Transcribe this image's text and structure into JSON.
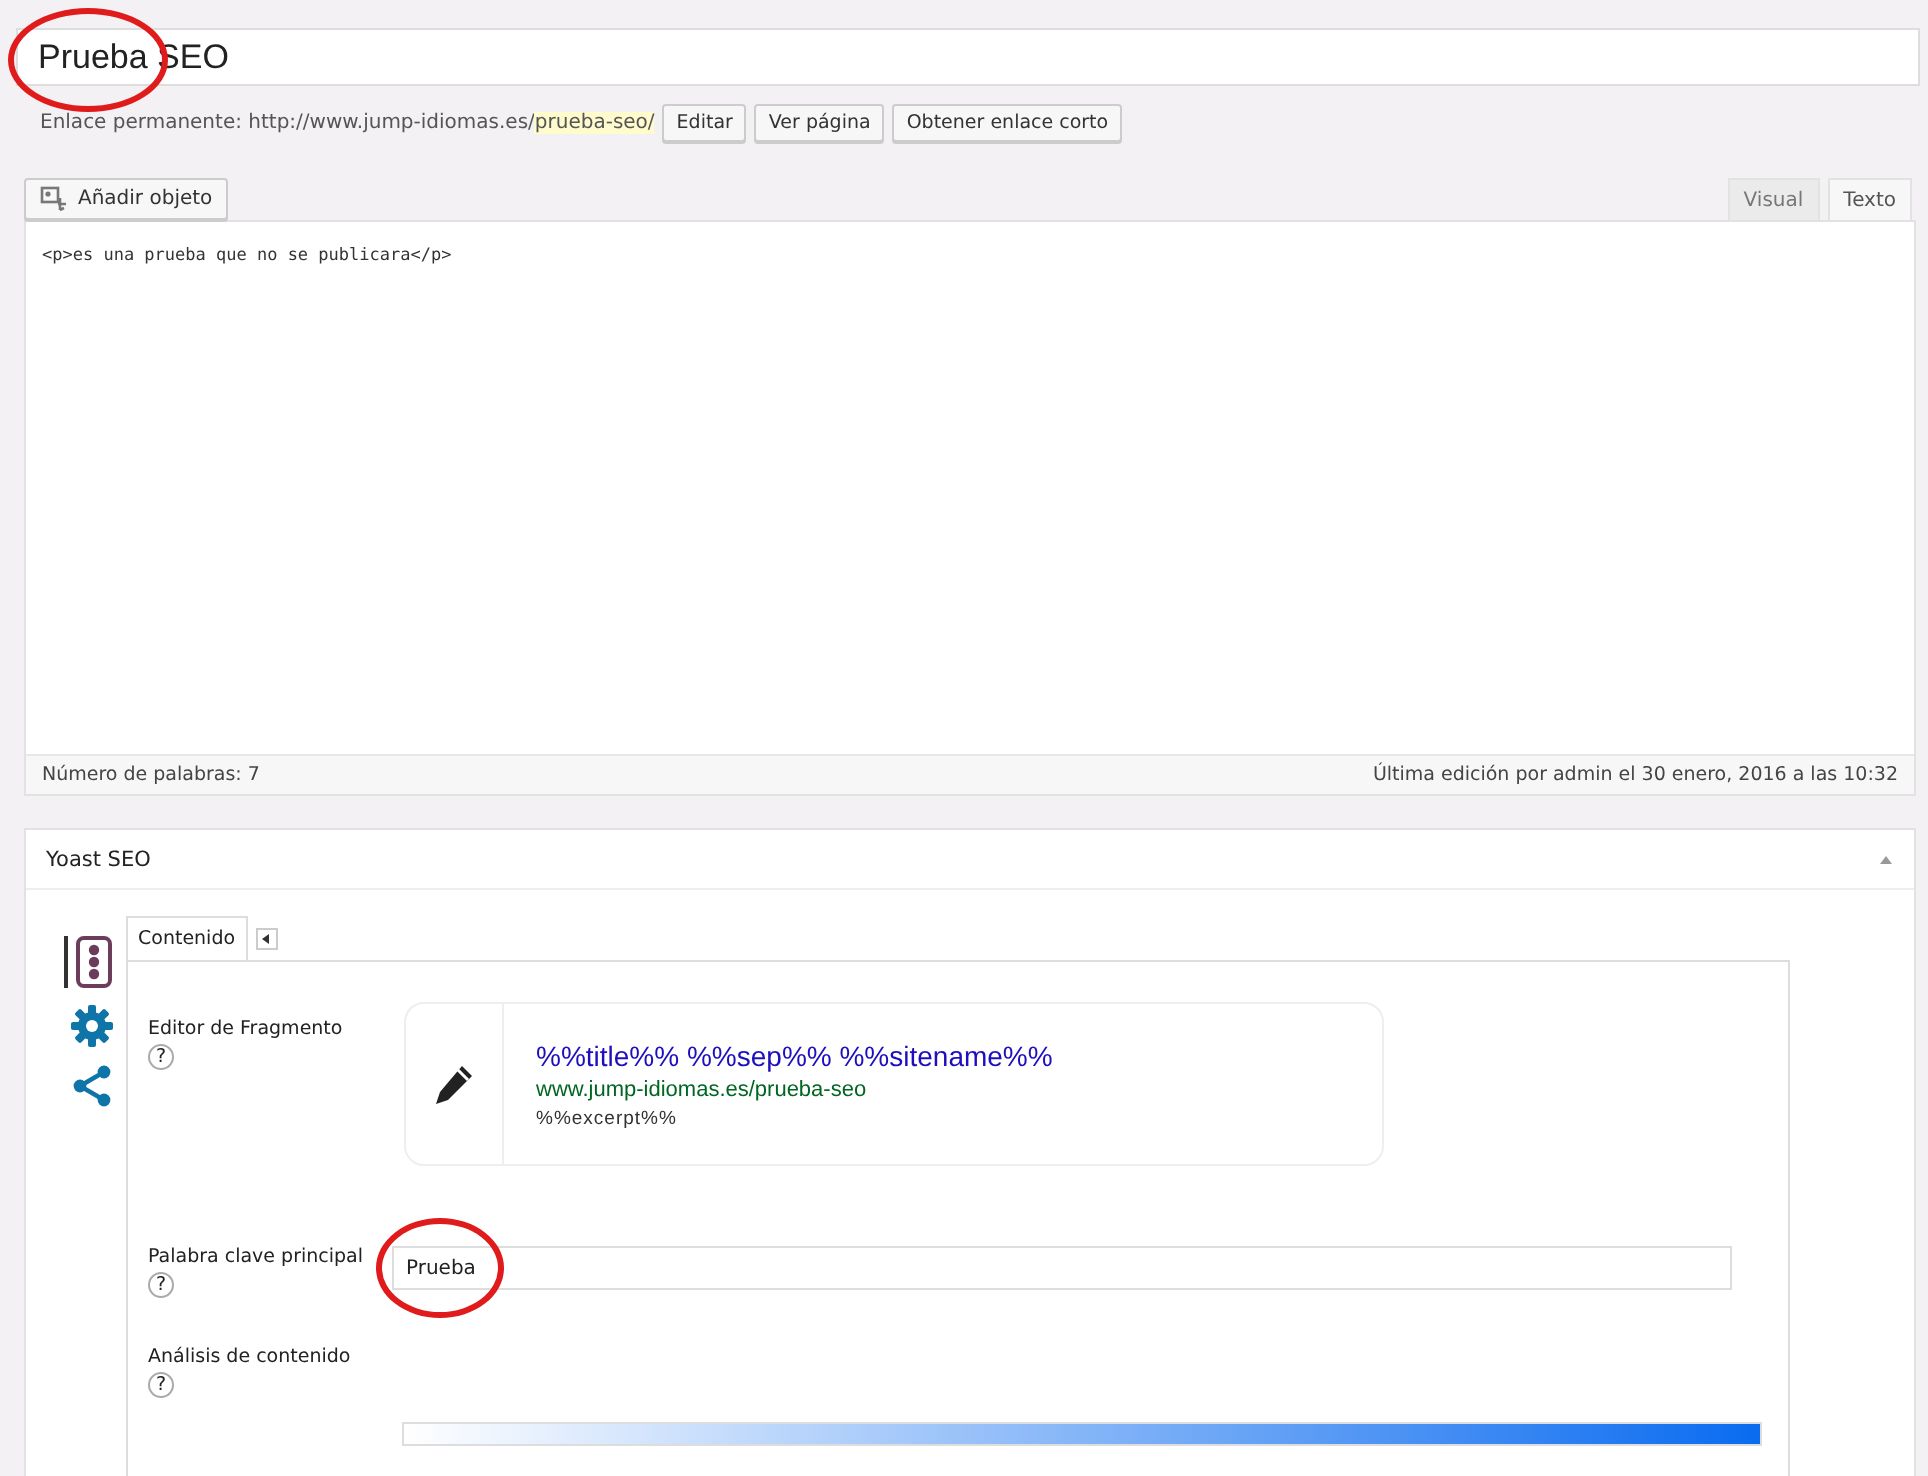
{
  "title": {
    "value": "Prueba SEO",
    "circled": true
  },
  "permalink": {
    "label": "Enlace permanente:",
    "base": "http://www.jump-idiomas.es/",
    "slug": "prueba-seo/",
    "buttons": [
      "Editar",
      "Ver página",
      "Obtener enlace corto"
    ]
  },
  "add_media": "Añadir objeto",
  "editor_tabs": [
    {
      "label": "Visual",
      "selected": false
    },
    {
      "label": "Texto",
      "selected": true
    }
  ],
  "content": "<p>es una prueba que no se publicara</p>",
  "word_count": "Número de palabras: 7",
  "last_edit": "Última edición por admin el 30 enero, 2016 a las 10:32",
  "yoast": {
    "title": "Yoast SEO",
    "expanded": true,
    "side_icons": [
      {
        "kind": "traffic",
        "selected": true
      },
      {
        "kind": "gear",
        "selected": false
      },
      {
        "kind": "share",
        "selected": false
      }
    ],
    "tabs": [
      {
        "label": "Contenido",
        "selected": true
      }
    ],
    "snippet": {
      "label": "Editor de Fragmento",
      "help": "?",
      "title": "%%title%% %%sep%% %%sitename%%",
      "url": "www.jump-idiomas.es/prueba-seo",
      "description": "%%excerpt%%"
    },
    "focus_keyword": {
      "label": "Palabra clave principal",
      "help": "?",
      "value": "Prueba",
      "circled": true
    },
    "analysis": {
      "label": "Análisis de contenido",
      "help": "?"
    }
  }
}
